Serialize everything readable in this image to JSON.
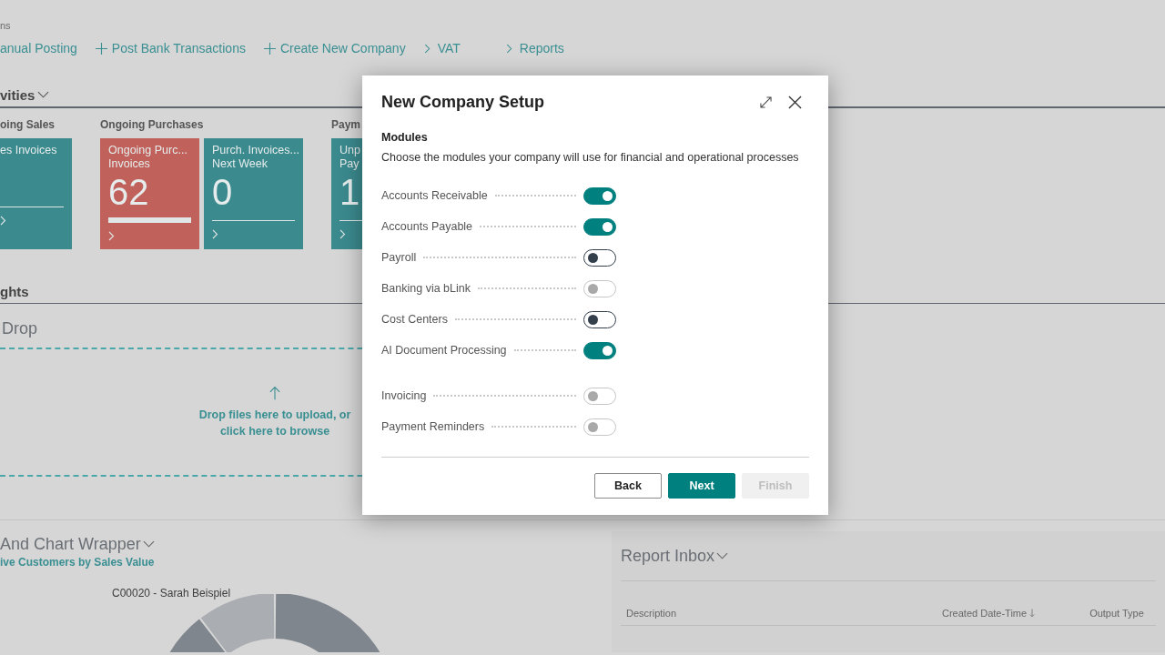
{
  "breadcrumb": "ns",
  "actions": [
    {
      "label": "anual Posting",
      "kind": "plain"
    },
    {
      "label": "Post Bank Transactions",
      "kind": "add"
    },
    {
      "label": "Create New Company",
      "kind": "add"
    },
    {
      "label": "VAT",
      "kind": "navigate"
    },
    {
      "label": "Reports",
      "kind": "navigate"
    }
  ],
  "activities": {
    "title": "vities",
    "groups": [
      {
        "title": "oing Sales",
        "tiles": [
          {
            "lines": [
              "es Invoices"
            ],
            "highlighted": false,
            "color": "#3b8a8e"
          }
        ]
      },
      {
        "title": "Ongoing Purchases",
        "tiles": [
          {
            "lines": [
              "Ongoing Purc...",
              "Invoices"
            ],
            "value": "62",
            "highlighted": true,
            "color": "#c0625b"
          },
          {
            "lines": [
              "Purch. Invoices...",
              "Next Week"
            ],
            "value": "0",
            "highlighted": false,
            "color": "#3b8a8e"
          }
        ]
      },
      {
        "title": "Paym",
        "tiles": [
          {
            "lines": [
              "Unp",
              "Pay"
            ],
            "value": "1",
            "highlighted": false,
            "color": "#3b8a8e"
          }
        ]
      }
    ]
  },
  "insights": {
    "title": "ghts"
  },
  "drop": {
    "title": "Drop",
    "text": "Drop files here to upload, or click here to browse"
  },
  "chart_part": {
    "title": "And Chart Wrapper",
    "subtitle": "ive Customers by Sales Value",
    "slice_label": "C00020 - Sarah Beispiel"
  },
  "report_inbox": {
    "title": "Report Inbox",
    "columns": [
      "Description",
      "Created Date-Time",
      "Output Type"
    ]
  },
  "dialog": {
    "title": "New Company Setup",
    "section": "Modules",
    "description": "Choose the modules your company will use for financial and operational processes",
    "groups": [
      {
        "modules": [
          {
            "label": "Accounts Receivable",
            "checked": true,
            "disabled": false
          },
          {
            "label": "Accounts Payable",
            "checked": true,
            "disabled": false
          },
          {
            "label": "Payroll",
            "checked": false,
            "disabled": false
          },
          {
            "label": "Banking via bLink",
            "checked": false,
            "disabled": true
          },
          {
            "label": "Cost Centers",
            "checked": false,
            "disabled": false
          },
          {
            "label": "AI Document Processing",
            "checked": true,
            "disabled": false
          }
        ]
      },
      {
        "modules": [
          {
            "label": "Invoicing",
            "checked": false,
            "disabled": true
          },
          {
            "label": "Payment Reminders",
            "checked": false,
            "disabled": true
          }
        ]
      }
    ],
    "buttons": [
      {
        "label": "Back",
        "kind": "secondary",
        "disabled": false
      },
      {
        "label": "Next",
        "kind": "primary",
        "disabled": false
      },
      {
        "label": "Finish",
        "kind": "secondary",
        "disabled": true
      }
    ]
  }
}
